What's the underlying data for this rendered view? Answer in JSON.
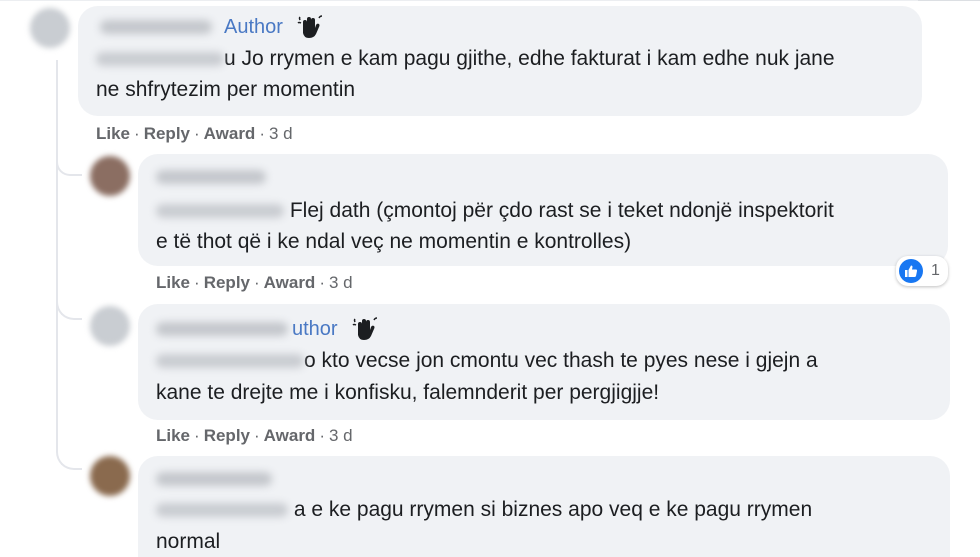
{
  "comments": [
    {
      "author_badge": "Author",
      "mention_suffix": "u",
      "text_line1": "Jo rrymen e kam pagu gjithe, edhe fakturat i kam edhe nuk jane",
      "text_line2": "ne shfrytezim per momentin",
      "actions": {
        "like": "Like",
        "reply": "Reply",
        "award": "Award",
        "time": "3 d"
      }
    },
    {
      "text_line1": "Flej dath (çmontoj për çdo rast se i teket ndonjë inspektorit",
      "text_line2": "e të thot që i ke ndal veç ne momentin e kontrolles)",
      "actions": {
        "like": "Like",
        "reply": "Reply",
        "award": "Award",
        "time": "3 d"
      },
      "reaction_count": "1"
    },
    {
      "author_badge": "uthor",
      "mention_suffix": "o",
      "text_line1": "kto vecse jon cmontu vec thash te pyes nese i gjejn a",
      "text_line2": "kane te drejte me i konfisku, falemnderit per pergjigjje!",
      "actions": {
        "like": "Like",
        "reply": "Reply",
        "award": "Award",
        "time": "3 d"
      }
    },
    {
      "text_line1": "a e ke pagu rrymen si biznes apo veq e ke pagu rrymen",
      "text_line2": "normal"
    }
  ],
  "separator": "·",
  "colors": {
    "bubble": "#f0f2f5",
    "author_badge": "#4a79c4",
    "like_blue": "#1877f2",
    "meta_gray": "#65676b"
  },
  "icons": {
    "badge": "waving-hand-icon",
    "reaction": "thumbs-up-icon"
  }
}
